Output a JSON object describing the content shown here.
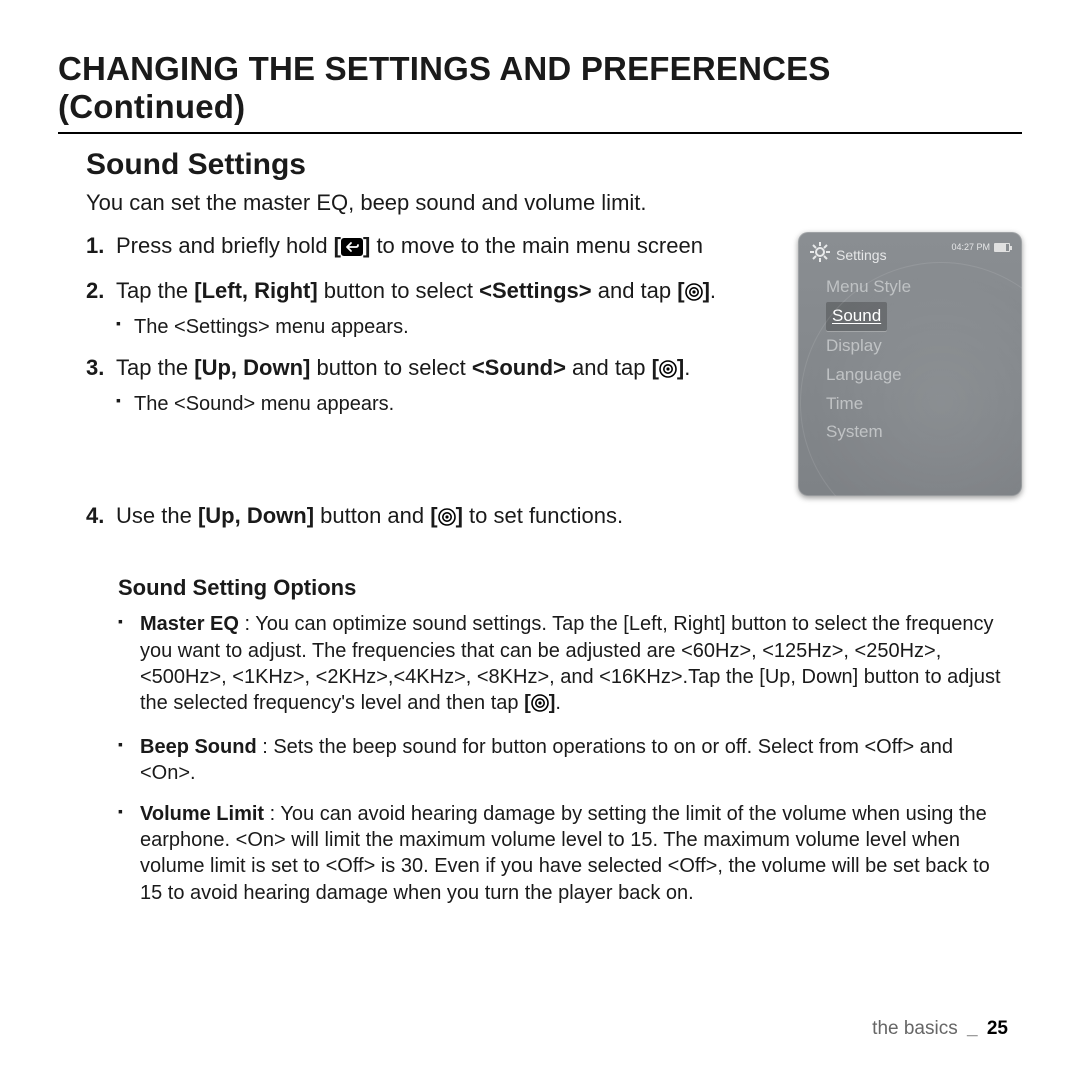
{
  "page_title": "CHANGING THE SETTINGS AND PREFERENCES (Continued)",
  "section_title": "Sound Settings",
  "intro": "You can set the master EQ, beep sound and volume limit.",
  "steps": {
    "s1a": "Press and briefly hold ",
    "s1b": " to move to the main menu screen",
    "s2a": "Tap the ",
    "s2b": "[Left, Right]",
    "s2c": " button to select ",
    "s2d": "<Settings>",
    "s2e": " and tap ",
    "s2sub": "The <Settings> menu appears.",
    "s3a": "Tap the ",
    "s3b": "[Up, Down]",
    "s3c": " button to select ",
    "s3d": "<Sound>",
    "s3e": " and tap ",
    "s3sub": "The <Sound> menu appears.",
    "s4a": "Use the ",
    "s4b": "[Up, Down]",
    "s4c": " button and ",
    "s4d": " to set functions."
  },
  "options_title": "Sound Setting Options",
  "options": {
    "o1_name": "Master EQ",
    "o1a": " : You can optimize sound settings. Tap the [Left, Right] button to select the frequency you want to adjust. The frequencies that can be adjusted are <60Hz>, <125Hz>, <250Hz>, <500Hz>, <1KHz>, <2KHz>,<4KHz>, <8KHz>, and <16KHz>.Tap the [Up, Down] button to adjust the selected frequency's level and then tap ",
    "o1b": ".",
    "o2_name": "Beep Sound",
    "o2": " : Sets the beep sound for button operations to on or off. Select from <Off> and <On>.",
    "o3_name": "Volume Limit",
    "o3": " : You can avoid hearing damage by setting the limit of the volume when using the earphone. <On> will limit the maximum volume level to 15. The maximum volume level when volume limit is set to <Off> is 30. Even if you have selected <Off>, the volume will be set back to 15 to avoid hearing damage when you turn the player back on."
  },
  "device": {
    "title": "Settings",
    "time": "04:27 PM",
    "items": [
      "Menu Style",
      "Sound",
      "Display",
      "Language",
      "Time",
      "System"
    ],
    "selected_index": 1
  },
  "footer": {
    "section": "the basics",
    "page": "25"
  },
  "icons": {
    "bracket_open": "[",
    "bracket_close": "]",
    "period": "."
  }
}
